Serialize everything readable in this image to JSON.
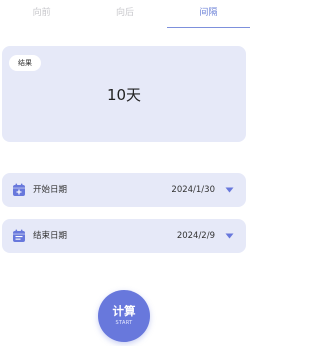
{
  "tabs": [
    {
      "label": "向前",
      "active": false
    },
    {
      "label": "向后",
      "active": false
    },
    {
      "label": "间隔",
      "active": true
    }
  ],
  "result": {
    "chip_label": "结果",
    "value": "10天"
  },
  "start_date": {
    "label": "开始日期",
    "value": "2024/1/30",
    "icon": "calendar-plus-icon"
  },
  "end_date": {
    "label": "结束日期",
    "value": "2024/2/9",
    "icon": "calendar-lines-icon"
  },
  "calculate": {
    "label": "计算",
    "sublabel": "START"
  },
  "colors": {
    "accent": "#6878dc",
    "card_bg": "#e6e9f8",
    "tab_inactive": "#c8c8cc",
    "tab_active": "#6f84d8"
  }
}
